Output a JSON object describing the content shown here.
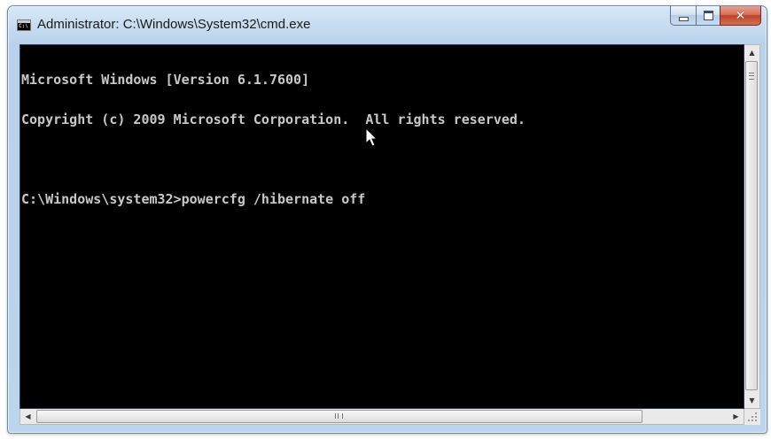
{
  "window": {
    "title": "Administrator: C:\\Windows\\System32\\cmd.exe",
    "icon": "cmd-icon",
    "icon_text": "C:\\",
    "controls": {
      "minimize": "minimize-icon",
      "maximize": "maximize-icon",
      "close_glyph": "✕"
    }
  },
  "console": {
    "lines": [
      "Microsoft Windows [Version 6.1.7600]",
      "Copyright (c) 2009 Microsoft Corporation.  All rights reserved.",
      "",
      "C:\\Windows\\system32>powercfg /hibernate off"
    ],
    "text_color": "#c8c8c8",
    "background": "#000000"
  },
  "scrollbars": {
    "up_arrow": "▲",
    "down_arrow": "▼",
    "left_arrow": "◀",
    "right_arrow": "▶"
  }
}
